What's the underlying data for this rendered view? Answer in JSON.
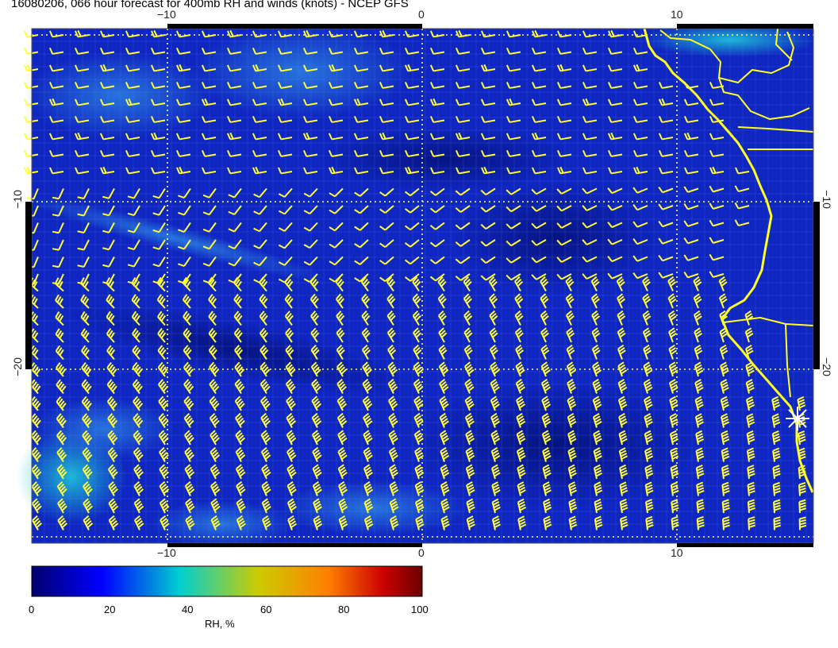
{
  "title": "16080206, 066 hour forecast for 400mb RH and winds (knots) - NCEP GFS",
  "axes": {
    "x_ticks_top": [
      "−10",
      "0",
      "10"
    ],
    "x_ticks_bottom": [
      "−10",
      "0",
      "10"
    ],
    "y_ticks_left": [
      "−10",
      "−20"
    ],
    "y_ticks_right": [
      "−10",
      "−20"
    ]
  },
  "colorbar": {
    "labels": [
      "0",
      "20",
      "40",
      "60",
      "80",
      "100"
    ],
    "title": "RH, %",
    "colors": [
      "#00008b",
      "#0000ff",
      "#00bfff",
      "#cccc00",
      "#ff8c00",
      "#ff0000",
      "#800000"
    ]
  },
  "map": {
    "background_color": "#0b1fb0",
    "barb_color": "#ffff33",
    "coast_color": "#ffff33",
    "marker": "station-star"
  }
}
